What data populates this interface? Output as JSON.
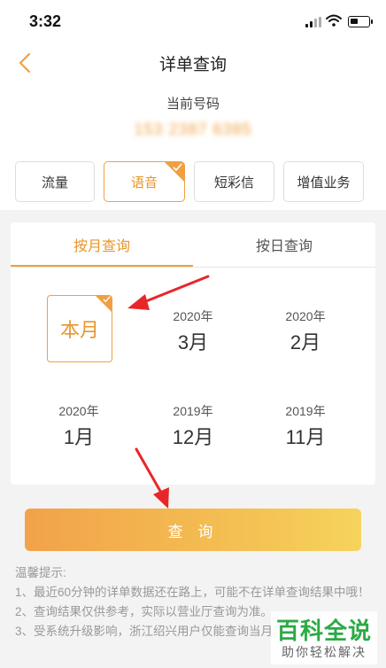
{
  "status": {
    "time": "3:32"
  },
  "header": {
    "title": "详单查询",
    "back_icon": "chevron-left-icon"
  },
  "number": {
    "label": "当前号码",
    "value": "153 2387 6385"
  },
  "tabs": [
    {
      "label": "流量",
      "active": false
    },
    {
      "label": "语音",
      "active": true
    },
    {
      "label": "短彩信",
      "active": false
    },
    {
      "label": "增值业务",
      "active": false
    }
  ],
  "query_mode": [
    {
      "label": "按月查询",
      "active": true
    },
    {
      "label": "按日查询",
      "active": false
    }
  ],
  "months": {
    "current": "本月",
    "items": [
      {
        "year": "2020年",
        "month": "3月"
      },
      {
        "year": "2020年",
        "month": "2月"
      },
      {
        "year": "2020年",
        "month": "1月"
      },
      {
        "year": "2019年",
        "month": "12月"
      },
      {
        "year": "2019年",
        "month": "11月"
      }
    ]
  },
  "query_button": "查 询",
  "tips": {
    "heading": "温馨提示:",
    "lines": [
      "1、最近60分钟的详单数据还在路上，可能不在详单查询结果中哦！",
      "2、查询结果仅供参考，实际以营业厅查询为准。",
      "3、受系统升级影响，浙江绍兴用户仅能查询当月详单。"
    ]
  },
  "watermark": {
    "main": "百科全说",
    "sub": "助你轻松解决"
  },
  "colors": {
    "accent": "#f0a040",
    "accent_text": "#e8962c",
    "arrow": "#e8262a",
    "watermark": "#2aaa44"
  }
}
